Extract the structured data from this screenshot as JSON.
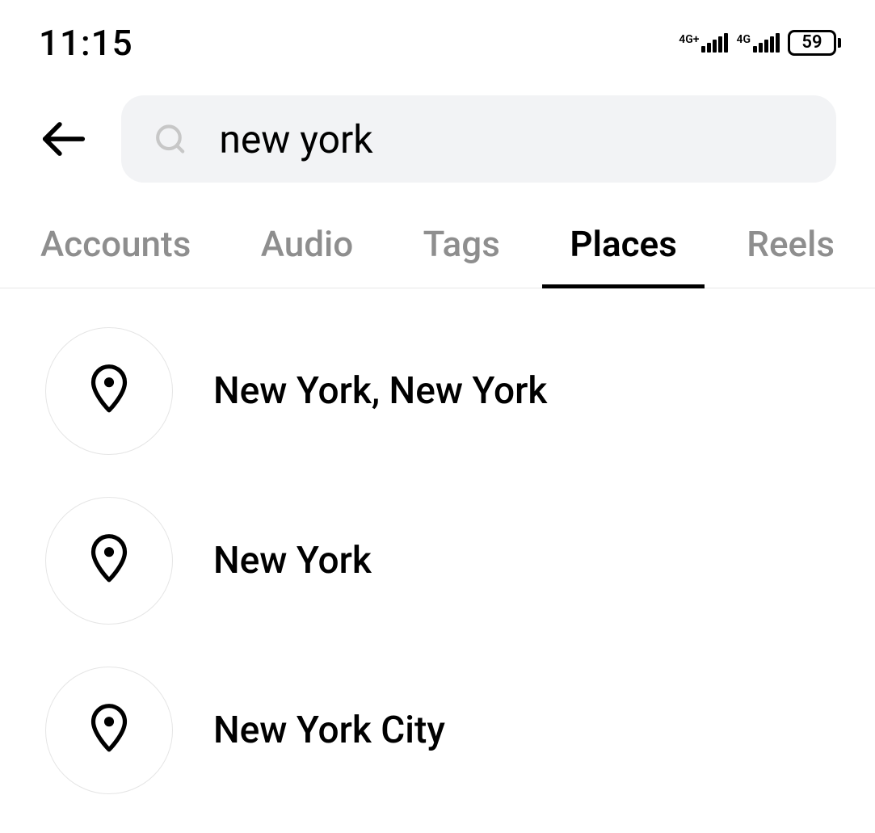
{
  "status_bar": {
    "time": "11:15",
    "signal1_label": "4G+",
    "signal2_label": "4G",
    "battery_level": "59"
  },
  "search": {
    "query": "new york"
  },
  "tabs": [
    {
      "label": "Accounts",
      "active": false
    },
    {
      "label": "Audio",
      "active": false
    },
    {
      "label": "Tags",
      "active": false
    },
    {
      "label": "Places",
      "active": true
    },
    {
      "label": "Reels",
      "active": false
    }
  ],
  "results": [
    {
      "label": "New York, New York"
    },
    {
      "label": "New York"
    },
    {
      "label": "New York City"
    }
  ]
}
